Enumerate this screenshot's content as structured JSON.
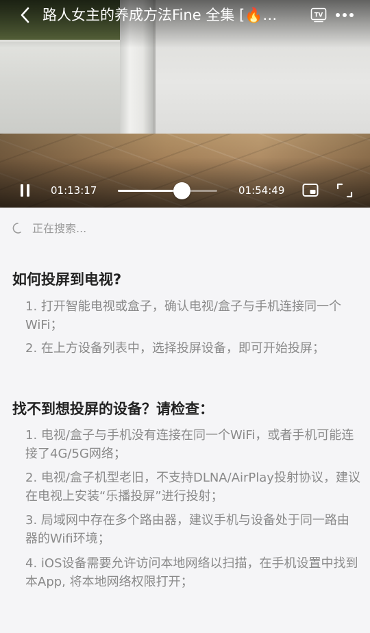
{
  "player": {
    "title": "路人女主的养成方法Fine 全集 [🔥…",
    "current_time": "01:13:17",
    "duration": "01:54:49",
    "progress_fraction": 0.64,
    "icons": {
      "back": "back-chevron-icon",
      "tv": "tv-icon",
      "more": "more-icon",
      "pause": "pause-icon",
      "pip": "picture-in-picture-icon",
      "fullscreen": "fullscreen-icon"
    },
    "tv_badge": "TV"
  },
  "cast": {
    "searching_text": "正在搜索..."
  },
  "help": {
    "how_title": "如何投屏到电视?",
    "how_items": [
      "1. 打开智能电视或盒子，确认电视/盒子与手机连接同一个WiFi；",
      "2. 在上方设备列表中，选择投屏设备，即可开始投屏；"
    ],
    "trouble_title": "找不到想投屏的设备？请检查：",
    "trouble_items": [
      "1. 电视/盒子与手机没有连接在同一个WiFi，或者手机可能连接了4G/5G网络；",
      "2. 电视/盒子机型老旧，不支持DLNA/AirPlay投射协议，建议在电视上安装“乐播投屏”进行投射；",
      "3. 局域网中存在多个路由器，建议手机与设备处于同一路由器的Wifi环境；",
      "4. iOS设备需要允许访问本地网络以扫描，在手机设置中找到本App, 将本地网络权限打开；"
    ]
  },
  "colors": {
    "background": "#f5f5f7",
    "heading": "#222222",
    "body_text": "#8a8a8a",
    "muted": "#999999"
  }
}
